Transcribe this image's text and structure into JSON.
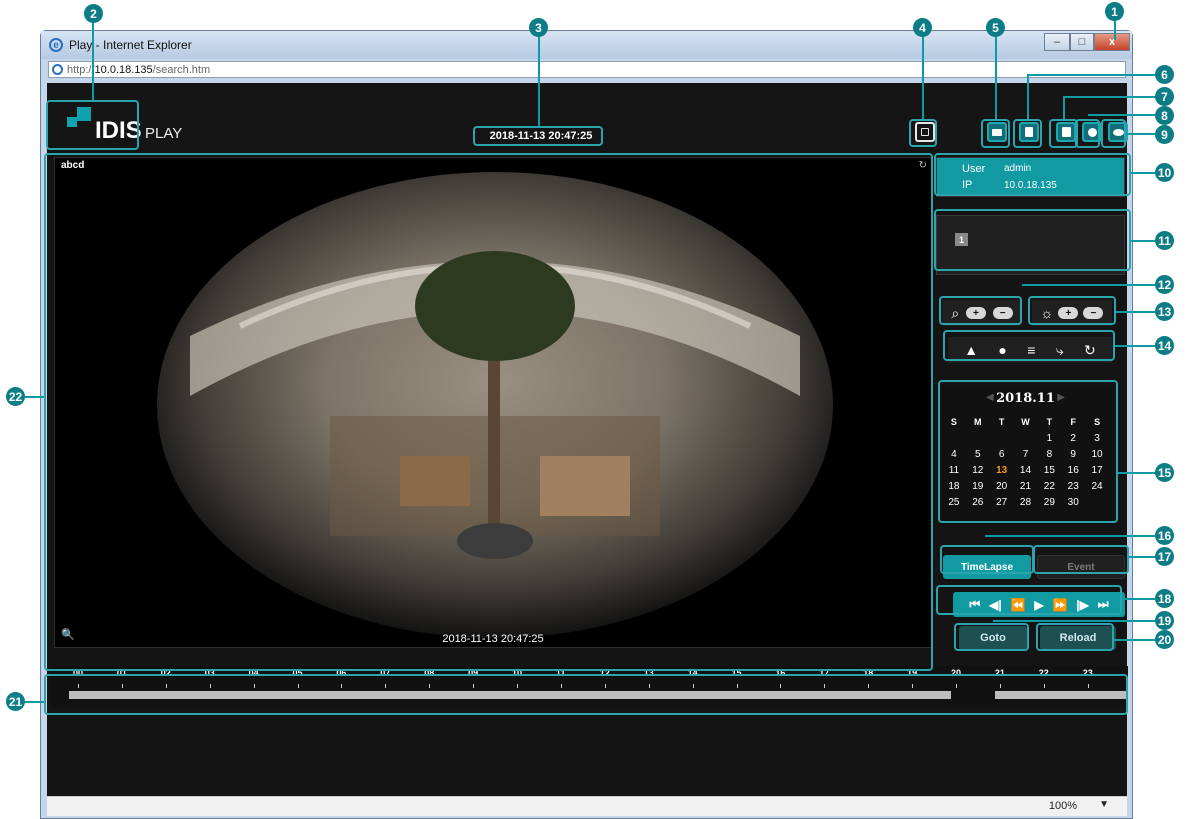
{
  "window": {
    "title": "Play - Internet Explorer",
    "controls": {
      "minimize": "–",
      "maximize": "□",
      "close": "x"
    }
  },
  "address_bar": {
    "prefix": "http://",
    "host": "10.0.18.135",
    "path": "/search.htm"
  },
  "header": {
    "logo_text": "IDIS",
    "logo_subtitle": "PLAY",
    "datetime": "2018-11-13 20:47:25",
    "icons": [
      "fullscreen-icon",
      "print-icon",
      "playback-icon",
      "snapshot-icon",
      "settings-icon",
      "view-icon"
    ]
  },
  "user_info": {
    "user_label": "User",
    "user_value": "admin",
    "ip_label": "IP",
    "ip_value": "10.0.18.135"
  },
  "camera_select": {
    "camera_number": "1"
  },
  "video": {
    "camera_name": "abcd",
    "timestamp": "2018-11-13 20:47:25"
  },
  "controls": {
    "zoom": {
      "plus": "+",
      "minus": "−"
    },
    "brightness": {
      "plus": "+",
      "minus": "−"
    },
    "image_tools": [
      "contrast-icon",
      "color-icon",
      "equalizer-icon",
      "dewarp-icon",
      "reset-icon"
    ]
  },
  "calendar": {
    "month_label": "2018.11",
    "day_names": [
      "S",
      "M",
      "T",
      "W",
      "T",
      "F",
      "S"
    ],
    "weeks": [
      [
        "",
        "",
        "",
        "",
        "1",
        "2",
        "3"
      ],
      [
        "4",
        "5",
        "6",
        "7",
        "8",
        "9",
        "10"
      ],
      [
        "11",
        "12",
        "13",
        "14",
        "15",
        "16",
        "17"
      ],
      [
        "18",
        "19",
        "20",
        "21",
        "22",
        "23",
        "24"
      ],
      [
        "25",
        "26",
        "27",
        "28",
        "29",
        "30",
        ""
      ]
    ],
    "selected_day": "13"
  },
  "mode_buttons": {
    "timelapse": "TimeLapse",
    "event": "Event"
  },
  "playback": {
    "buttons": [
      "first-frame",
      "previous-frame",
      "fast-rewind",
      "play",
      "fast-forward",
      "next-frame",
      "last-frame"
    ]
  },
  "actions": {
    "goto": "Goto",
    "reload": "Reload"
  },
  "timeline": {
    "hours": [
      "00",
      "01",
      "02",
      "03",
      "04",
      "05",
      "06",
      "07",
      "08",
      "09",
      "10",
      "11",
      "12",
      "13",
      "14",
      "15",
      "16",
      "17",
      "18",
      "19",
      "20",
      "21",
      "22",
      "23"
    ],
    "recorded_from_hour": 20.0,
    "recorded_to_hour": 21.0
  },
  "status_bar": {
    "zoom": "100%"
  },
  "callouts": [
    "1",
    "2",
    "3",
    "4",
    "5",
    "6",
    "7",
    "8",
    "9",
    "10",
    "11",
    "12",
    "13",
    "14",
    "15",
    "16",
    "17",
    "18",
    "19",
    "20",
    "21",
    "22"
  ],
  "colors": {
    "accent": "#129aa3",
    "callout": "#0c7d86",
    "today": "#f39a1d",
    "background": "#141414"
  }
}
